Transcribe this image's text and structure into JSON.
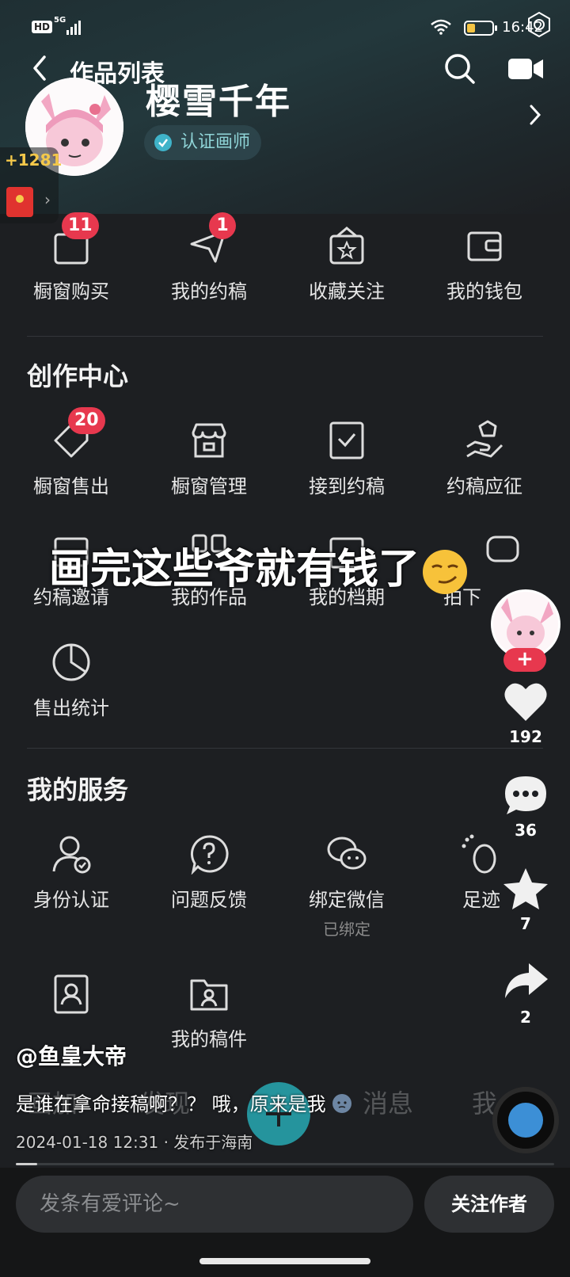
{
  "status_bar": {
    "hd": "HD",
    "network": "5G",
    "time": "16:42"
  },
  "nav": {
    "title": "作品列表"
  },
  "profile": {
    "name": "樱雪千年",
    "cert_label": "认证画师",
    "coins": "+1281"
  },
  "quick_actions": [
    {
      "label": "橱窗购买",
      "badge": "11",
      "icon": "bag-icon"
    },
    {
      "label": "我的约稿",
      "badge": "1",
      "icon": "send-icon"
    },
    {
      "label": "收藏关注",
      "badge": "",
      "icon": "star-box-icon"
    },
    {
      "label": "我的钱包",
      "badge": "",
      "icon": "wallet-icon"
    }
  ],
  "creation_center": {
    "title": "创作中心",
    "items": [
      {
        "label": "橱窗售出",
        "badge": "20",
        "icon": "tag-icon"
      },
      {
        "label": "橱窗管理",
        "badge": "",
        "icon": "store-icon"
      },
      {
        "label": "接到约稿",
        "badge": "",
        "icon": "checkbox-icon"
      },
      {
        "label": "约稿应征",
        "badge": "",
        "icon": "hand-gem-icon"
      },
      {
        "label": "约稿邀请",
        "badge": "",
        "icon": "invite-icon"
      },
      {
        "label": "我的作品",
        "badge": "",
        "icon": "grid-icon"
      },
      {
        "label": "我的档期",
        "badge": "",
        "icon": "calendar-icon"
      },
      {
        "label": "拍下",
        "badge": "",
        "icon": "bubble-icon"
      },
      {
        "label": "售出统计",
        "badge": "",
        "icon": "pie-chart-icon"
      }
    ]
  },
  "services": {
    "title": "我的服务",
    "items": [
      {
        "label": "身份认证",
        "sub": "",
        "icon": "user-check-icon"
      },
      {
        "label": "问题反馈",
        "sub": "",
        "icon": "question-icon"
      },
      {
        "label": "绑定微信",
        "sub": "已绑定",
        "icon": "wechat-icon"
      },
      {
        "label": "足迹",
        "sub": "",
        "icon": "footprint-icon"
      },
      {
        "label": "",
        "sub": "",
        "icon": "id-card-icon"
      },
      {
        "label": "我的稿件",
        "sub": "",
        "icon": "folder-user-icon"
      }
    ]
  },
  "overlay_caption": "画完这些爷就有钱了",
  "rail": {
    "follow_symbol": "+",
    "likes": "192",
    "comments": "36",
    "favorites": "7",
    "shares": "2"
  },
  "post": {
    "author": "@鱼皇大帝",
    "text": "是谁在拿命接稿啊？？ 哦，原来是我",
    "meta": "2024-01-18 12:31 · 发布于海南"
  },
  "ghost_tabs": [
    "画加",
    "发现",
    "消息",
    "我"
  ],
  "video_progress": 0.04,
  "bottom": {
    "comment_placeholder": "发条有爱评论~",
    "follow_label": "关注作者"
  },
  "colors": {
    "badge": "#e7384e",
    "accent": "#27a9b3",
    "coin": "#f4c84a"
  }
}
